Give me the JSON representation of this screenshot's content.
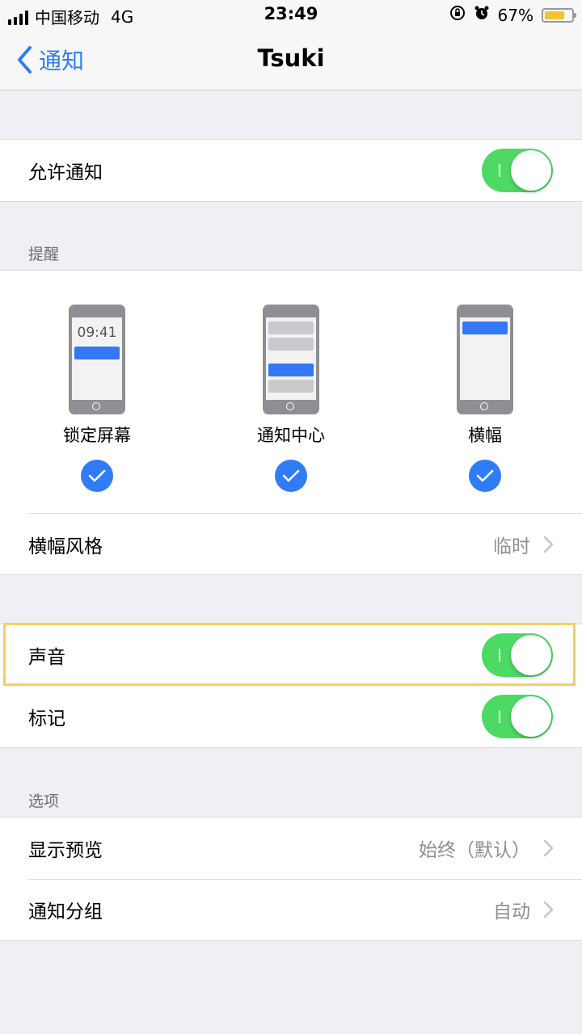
{
  "status_bar": {
    "carrier": "中国移动",
    "network": "4G",
    "time": "23:49",
    "battery_percent": "67%",
    "battery_level": 0.67,
    "icons": [
      "signal-icon",
      "orientation-lock-icon",
      "alarm-icon",
      "battery-icon"
    ]
  },
  "nav": {
    "back_label": "通知",
    "title": "Tsuki"
  },
  "allow": {
    "label": "允许通知",
    "on": true
  },
  "alerts": {
    "header": "提醒",
    "phone_time": "09:41",
    "items": [
      {
        "label": "锁定屏幕",
        "checked": true
      },
      {
        "label": "通知中心",
        "checked": true
      },
      {
        "label": "横幅",
        "checked": true
      }
    ],
    "banner_style": {
      "label": "横幅风格",
      "value": "临时"
    }
  },
  "sounds": {
    "sound": {
      "label": "声音",
      "on": true
    },
    "badge": {
      "label": "标记",
      "on": true
    }
  },
  "options": {
    "header": "选项",
    "show_preview": {
      "label": "显示预览",
      "value": "始终（默认）"
    },
    "grouping": {
      "label": "通知分组",
      "value": "自动"
    }
  },
  "colors": {
    "accent": "#2f7cf6",
    "toggle_on": "#4cd964",
    "highlight": "#f2cf63",
    "background": "#efeff4"
  }
}
